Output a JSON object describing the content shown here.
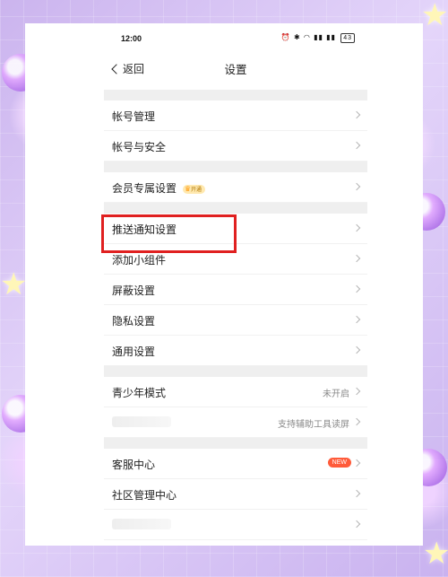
{
  "statusbar": {
    "time": "12:00",
    "icons": "⏰ ✱ ◠ ▮▮ ▮▮",
    "battery": "43"
  },
  "navbar": {
    "back_label": "返回",
    "title": "设置"
  },
  "groups": [
    {
      "items": [
        {
          "label": "帐号管理"
        },
        {
          "label": "帐号与安全"
        }
      ]
    },
    {
      "items": [
        {
          "label": "会员专属设置",
          "badge": "开通"
        }
      ]
    },
    {
      "items": [
        {
          "label": "推送通知设置"
        },
        {
          "label": "添加小组件"
        },
        {
          "label": "屏蔽设置"
        },
        {
          "label": "隐私设置"
        },
        {
          "label": "通用设置"
        }
      ]
    },
    {
      "items": [
        {
          "label": "青少年模式",
          "value": "未开启"
        },
        {
          "label": "",
          "value": "支持辅助工具读屏"
        }
      ]
    },
    {
      "items": [
        {
          "label": "客服中心",
          "badge": "NEW"
        },
        {
          "label": "社区管理中心"
        },
        {
          "label": ""
        },
        {
          "label": ""
        }
      ]
    }
  ],
  "colors": {
    "accent_badge": "#ff5b3a",
    "highlight": "#e02020"
  },
  "icons": {
    "back": "chevron-left-icon",
    "row_arrow": "chevron-right-icon",
    "vip": "crown-icon"
  }
}
